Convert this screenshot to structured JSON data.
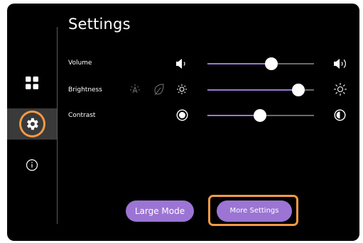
{
  "settings": {
    "title": "Settings",
    "rows": [
      {
        "label": "Volume",
        "level": 0.6
      },
      {
        "label": "Brightness",
        "level": 0.85
      },
      {
        "label": "Contrast",
        "level": 0.49
      }
    ]
  },
  "sidebar": {
    "items": [
      {
        "icon": "grid-icon",
        "active": false
      },
      {
        "icon": "gear-icon",
        "active": true
      },
      {
        "icon": "info-icon",
        "active": false
      }
    ]
  },
  "buttons": {
    "large_mode": "Large Mode",
    "more_settings": "More Settings"
  },
  "colors": {
    "accent": "#9b74d4",
    "highlight": "#f29a45",
    "panel": "#000000"
  }
}
